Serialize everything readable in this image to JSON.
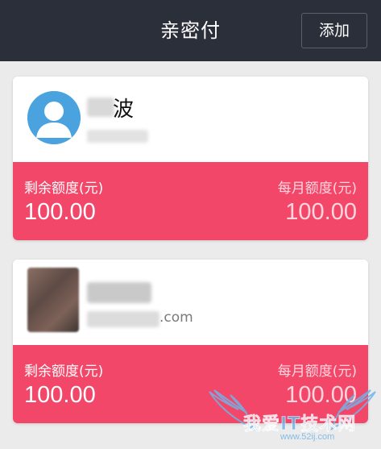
{
  "header": {
    "title": "亲密付",
    "add_label": "添加"
  },
  "cards": [
    {
      "name_visible": "波",
      "remaining_label": "剩余额度(元)",
      "remaining_amount": "100.00",
      "monthly_label": "每月额度(元)",
      "monthly_amount": "100.00"
    },
    {
      "email_suffix": ".com",
      "remaining_label": "剩余额度(元)",
      "remaining_amount": "100.00",
      "monthly_label": "每月额度(元)",
      "monthly_amount": "100.00"
    }
  ],
  "watermark": {
    "text": "我爱IT技术网",
    "url": "www.52ij.com"
  },
  "colors": {
    "topbar": "#2b2f3a",
    "quota_band": "#f3476a",
    "avatar_blue": "#4aa3df",
    "page_bg": "#ebebeb"
  },
  "icons": {
    "avatar_placeholder": "default-user-icon"
  }
}
